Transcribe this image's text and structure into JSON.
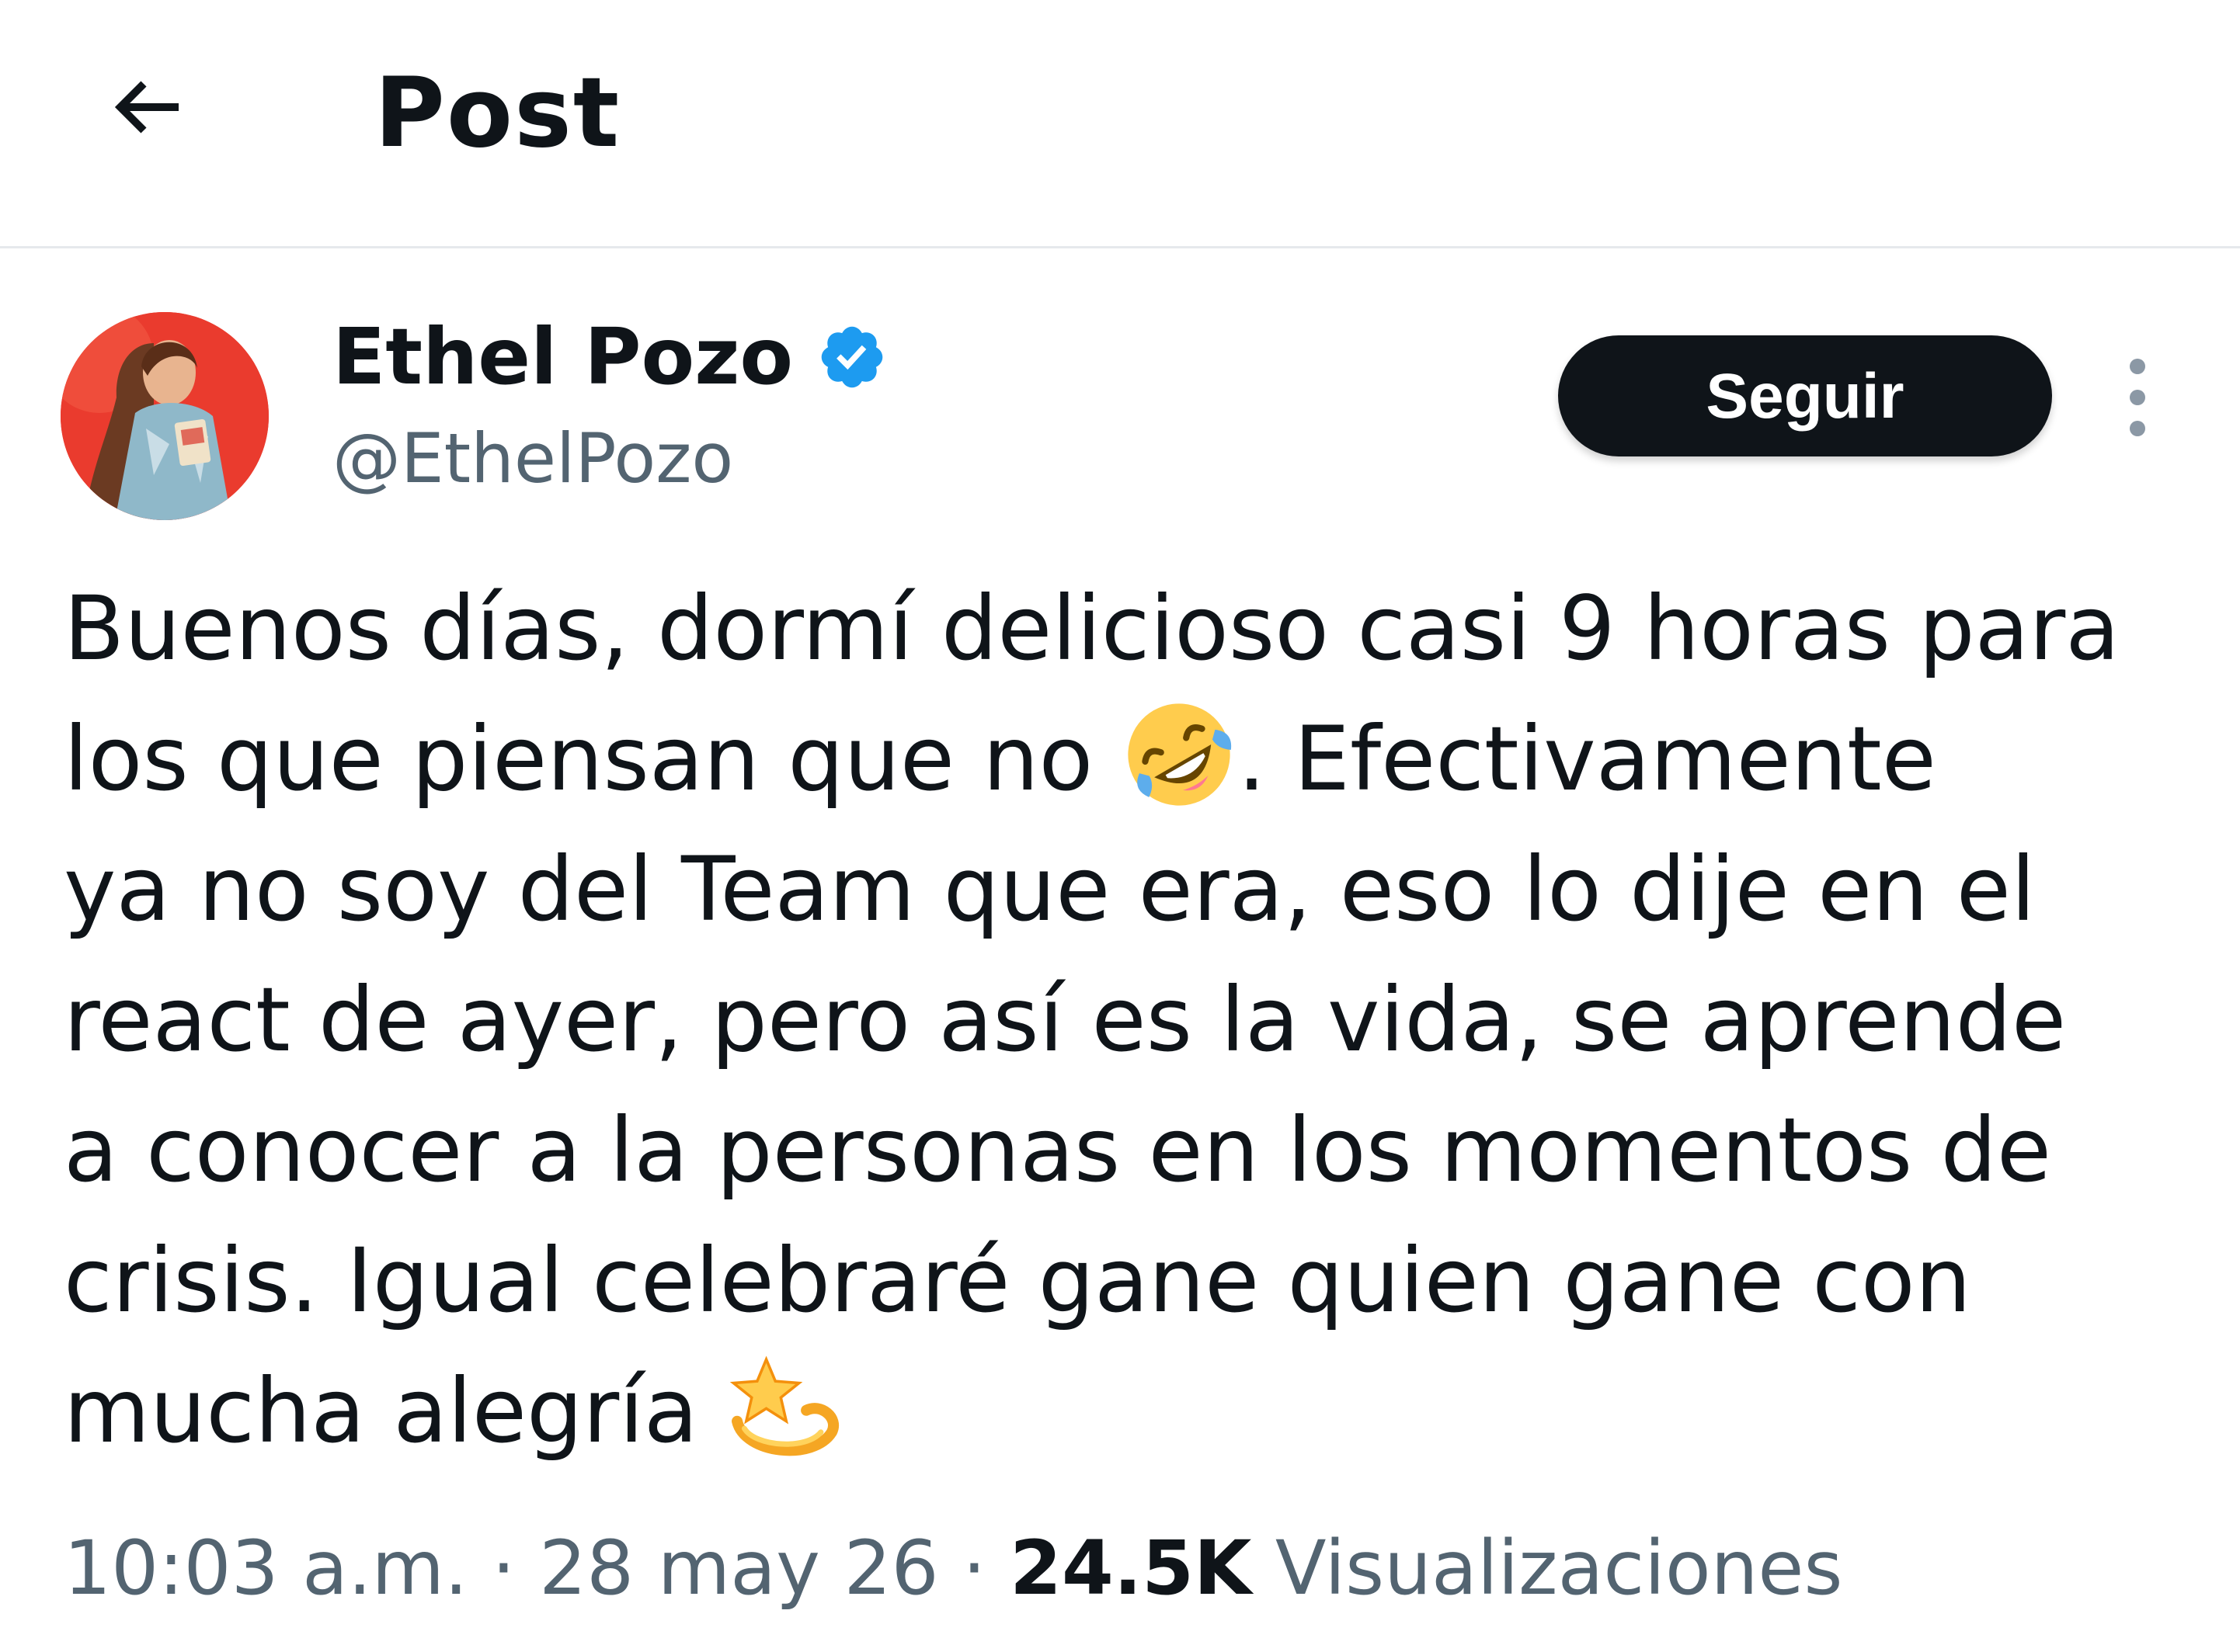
{
  "header": {
    "title": "Post",
    "back_icon": "arrow-left-icon"
  },
  "author": {
    "name": "Ethel Pozo",
    "handle": "@EthelPozo",
    "verified_icon": "verified-badge-icon",
    "verified_color": "#1d9bf0",
    "avatar_bg": "#ea3b2e"
  },
  "actions": {
    "follow_label": "Seguir",
    "more_icon": "more-vertical-icon"
  },
  "post": {
    "lines": [
      {
        "text": "Buenos días, dormí delicioso casi 9 horas para"
      },
      {
        "before": "los que piensan que no ",
        "emoji": "rolling-on-floor-laughing-emoji",
        "after": ". Efectivamente"
      },
      {
        "text": "ya no soy del Team que era, eso lo dije en el"
      },
      {
        "text": "react de ayer, pero así es la vida, se aprende"
      },
      {
        "text": "a conocer a la personas en los momentos de"
      },
      {
        "text": "crisis. Igual celebraré gane quien gane con"
      },
      {
        "before": "mucha alegría ",
        "emoji": "dizzy-star-emoji"
      }
    ]
  },
  "meta": {
    "time": "10:03 a.m.",
    "separator": " · ",
    "date": "28 may 26",
    "views_count": "24.5K",
    "views_label": " Visualizaciones"
  }
}
